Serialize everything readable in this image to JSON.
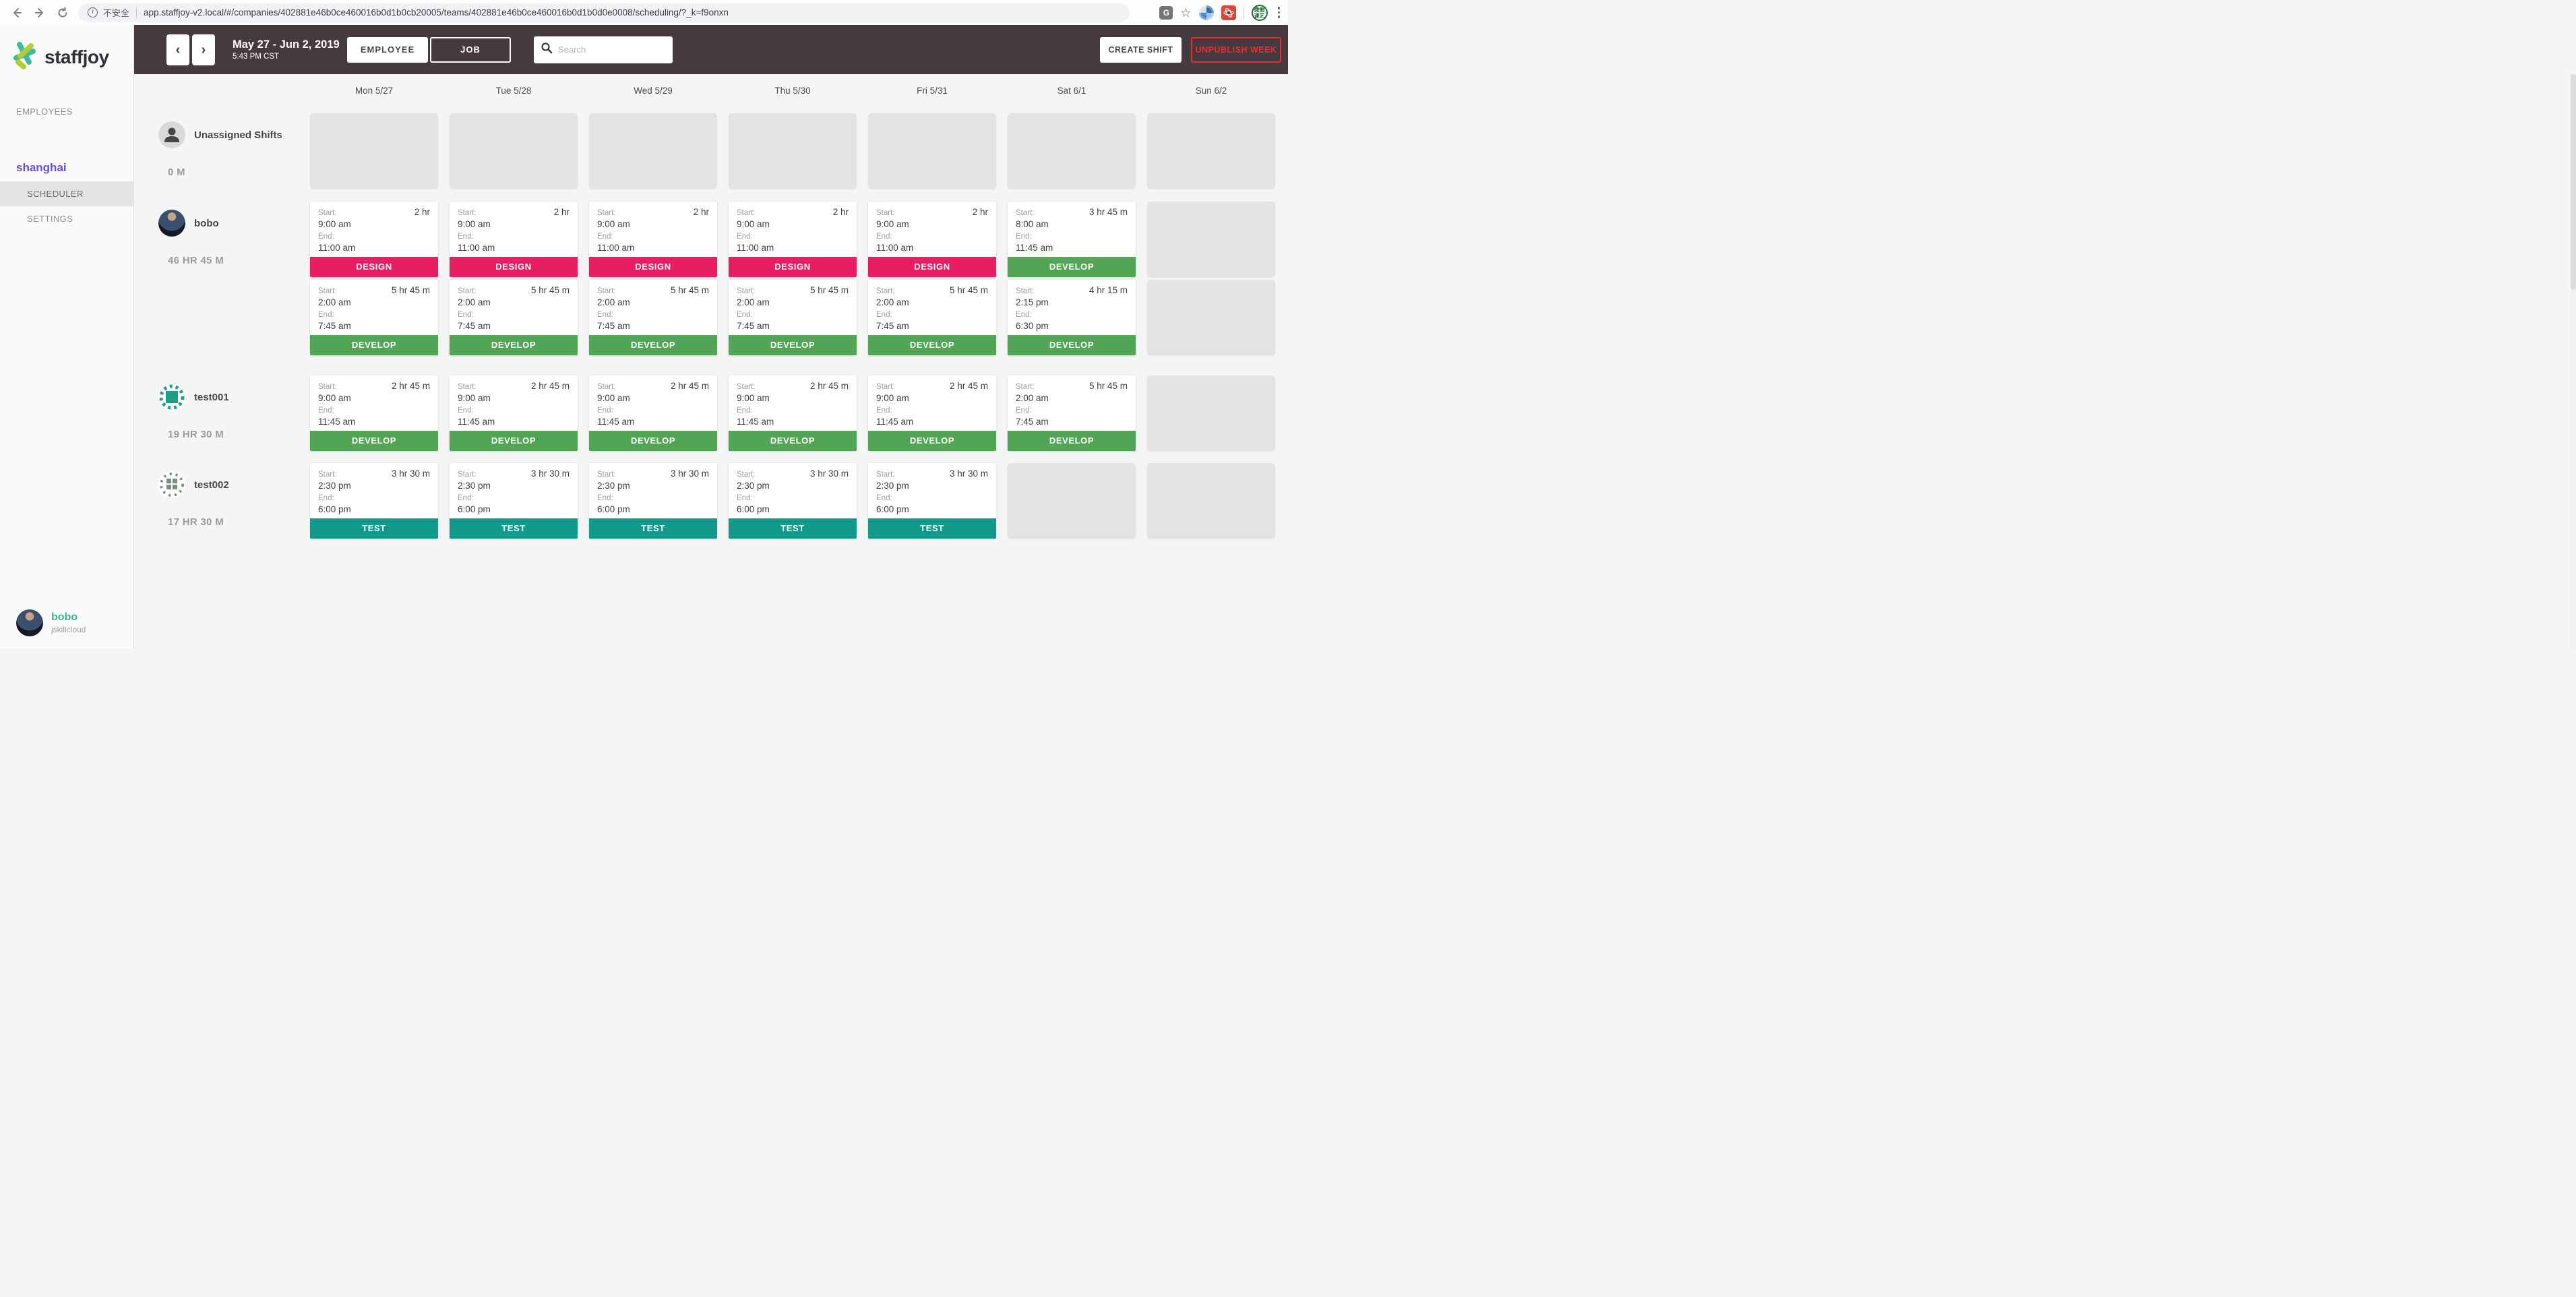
{
  "browser": {
    "security_label": "不安全",
    "url": "app.staffjoy-v2.local/#/companies/402881e46b0ce460016b0d1b0cb20005/teams/402881e46b0ce460016b0d1b0d0e0008/scheduling/?_k=f9onxn",
    "icons": {
      "info_glyph": "i",
      "translate_glyph": "G",
      "star_glyph": "☆",
      "extension_badge": "微掘课艺"
    }
  },
  "sidebar": {
    "logo_text": "staffjoy",
    "items": [
      {
        "label": "EMPLOYEES"
      }
    ],
    "team": "shanghai",
    "team_items": [
      {
        "label": "SCHEDULER",
        "active": true
      },
      {
        "label": "SETTINGS",
        "active": false
      }
    ],
    "user": {
      "name": "bobo",
      "company": "jskillcloud"
    }
  },
  "header": {
    "prev_glyph": "‹",
    "next_glyph": "›",
    "date_range": "May 27 - Jun 2, 2019",
    "time": "5:43 PM CST",
    "toggle_employee": "EMPLOYEE",
    "toggle_job": "JOB",
    "search_placeholder": "Search",
    "create_shift": "CREATE SHIFT",
    "unpublish_week": "UNPUBLISH WEEK"
  },
  "schedule": {
    "days": [
      "Mon 5/27",
      "Tue 5/28",
      "Wed 5/29",
      "Thu 5/30",
      "Fri 5/31",
      "Sat 6/1",
      "Sun 6/2"
    ],
    "labels": {
      "start": "Start:",
      "end": "End:"
    },
    "jobs": {
      "DESIGN": "#e81d62",
      "DEVELOP": "#53a556",
      "TEST": "#11998c"
    },
    "rows": [
      {
        "name": "Unassigned Shifts",
        "avatar": "person",
        "hours": "0 M",
        "slots": [
          [
            null,
            null,
            null,
            null,
            null,
            null,
            null
          ]
        ]
      },
      {
        "name": "bobo",
        "avatar": "photo",
        "hours": "46 HR 45 M",
        "slots": [
          [
            {
              "duration": "2 hr",
              "start": "9:00 am",
              "end": "11:00 am",
              "job": "DESIGN"
            },
            {
              "duration": "2 hr",
              "start": "9:00 am",
              "end": "11:00 am",
              "job": "DESIGN"
            },
            {
              "duration": "2 hr",
              "start": "9:00 am",
              "end": "11:00 am",
              "job": "DESIGN"
            },
            {
              "duration": "2 hr",
              "start": "9:00 am",
              "end": "11:00 am",
              "job": "DESIGN"
            },
            {
              "duration": "2 hr",
              "start": "9:00 am",
              "end": "11:00 am",
              "job": "DESIGN"
            },
            {
              "duration": "3 hr 45 m",
              "start": "8:00 am",
              "end": "11:45 am",
              "job": "DEVELOP"
            },
            null
          ],
          [
            {
              "duration": "5 hr 45 m",
              "start": "2:00 am",
              "end": "7:45 am",
              "job": "DEVELOP"
            },
            {
              "duration": "5 hr 45 m",
              "start": "2:00 am",
              "end": "7:45 am",
              "job": "DEVELOP"
            },
            {
              "duration": "5 hr 45 m",
              "start": "2:00 am",
              "end": "7:45 am",
              "job": "DEVELOP"
            },
            {
              "duration": "5 hr 45 m",
              "start": "2:00 am",
              "end": "7:45 am",
              "job": "DEVELOP"
            },
            {
              "duration": "5 hr 45 m",
              "start": "2:00 am",
              "end": "7:45 am",
              "job": "DEVELOP"
            },
            {
              "duration": "4 hr 15 m",
              "start": "2:15 pm",
              "end": "6:30 pm",
              "job": "DEVELOP"
            },
            null
          ]
        ]
      },
      {
        "name": "test001",
        "avatar": "identicon-teal",
        "hours": "19 HR 30 M",
        "slots": [
          [
            {
              "duration": "2 hr 45 m",
              "start": "9:00 am",
              "end": "11:45 am",
              "job": "DEVELOP"
            },
            {
              "duration": "2 hr 45 m",
              "start": "9:00 am",
              "end": "11:45 am",
              "job": "DEVELOP"
            },
            {
              "duration": "2 hr 45 m",
              "start": "9:00 am",
              "end": "11:45 am",
              "job": "DEVELOP"
            },
            {
              "duration": "2 hr 45 m",
              "start": "9:00 am",
              "end": "11:45 am",
              "job": "DEVELOP"
            },
            {
              "duration": "2 hr 45 m",
              "start": "9:00 am",
              "end": "11:45 am",
              "job": "DEVELOP"
            },
            {
              "duration": "5 hr 45 m",
              "start": "2:00 am",
              "end": "7:45 am",
              "job": "DEVELOP"
            },
            null
          ]
        ]
      },
      {
        "name": "test002",
        "avatar": "identicon-green",
        "hours": "17 HR 30 M",
        "slots": [
          [
            {
              "duration": "3 hr 30 m",
              "start": "2:30 pm",
              "end": "6:00 pm",
              "job": "TEST"
            },
            {
              "duration": "3 hr 30 m",
              "start": "2:30 pm",
              "end": "6:00 pm",
              "job": "TEST"
            },
            {
              "duration": "3 hr 30 m",
              "start": "2:30 pm",
              "end": "6:00 pm",
              "job": "TEST"
            },
            {
              "duration": "3 hr 30 m",
              "start": "2:30 pm",
              "end": "6:00 pm",
              "job": "TEST"
            },
            {
              "duration": "3 hr 30 m",
              "start": "2:30 pm",
              "end": "6:00 pm",
              "job": "TEST"
            },
            null,
            null
          ]
        ]
      }
    ]
  }
}
